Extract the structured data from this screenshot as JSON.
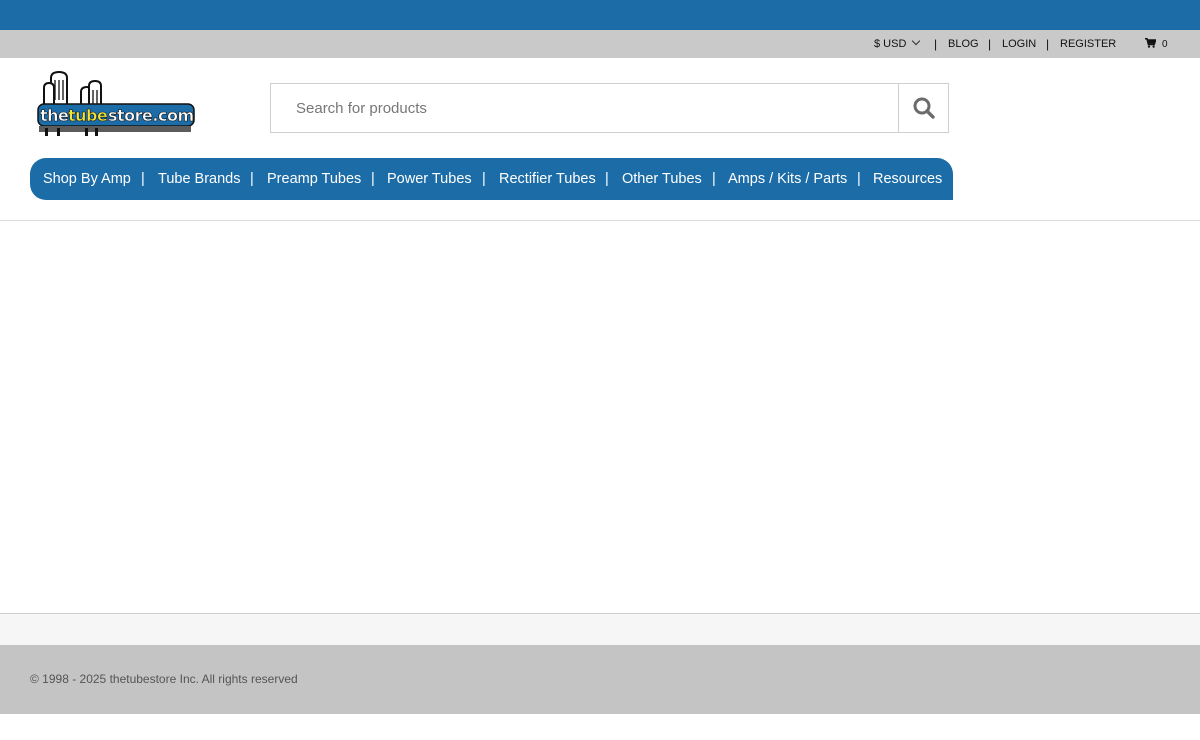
{
  "colors": {
    "brand_blue": "#1c6ca8",
    "utility_gray": "#c9c9c9",
    "footer_gray": "#c4c4c4",
    "logo_yellow": "#f3e53a"
  },
  "utility": {
    "currency": "$ USD",
    "separator": "|",
    "blog": "BLOG",
    "login": "LOGIN",
    "register": "REGISTER",
    "cart_icon": "cart-icon",
    "cart_count": "0"
  },
  "logo": {
    "text_prefix": "the",
    "text_mid": "tube",
    "text_suffix": "store.com"
  },
  "search": {
    "placeholder": "Search for products",
    "value": "",
    "icon": "search-icon"
  },
  "nav": {
    "separator": "|",
    "items": [
      "Shop By Amp",
      "Tube Brands",
      "Preamp Tubes",
      "Power Tubes",
      "Rectifier Tubes",
      "Other Tubes",
      "Amps / Kits / Parts",
      "Resources"
    ]
  },
  "footer": {
    "copyright": "© 1998 - 2025 thetubestore Inc. All rights reserved"
  }
}
